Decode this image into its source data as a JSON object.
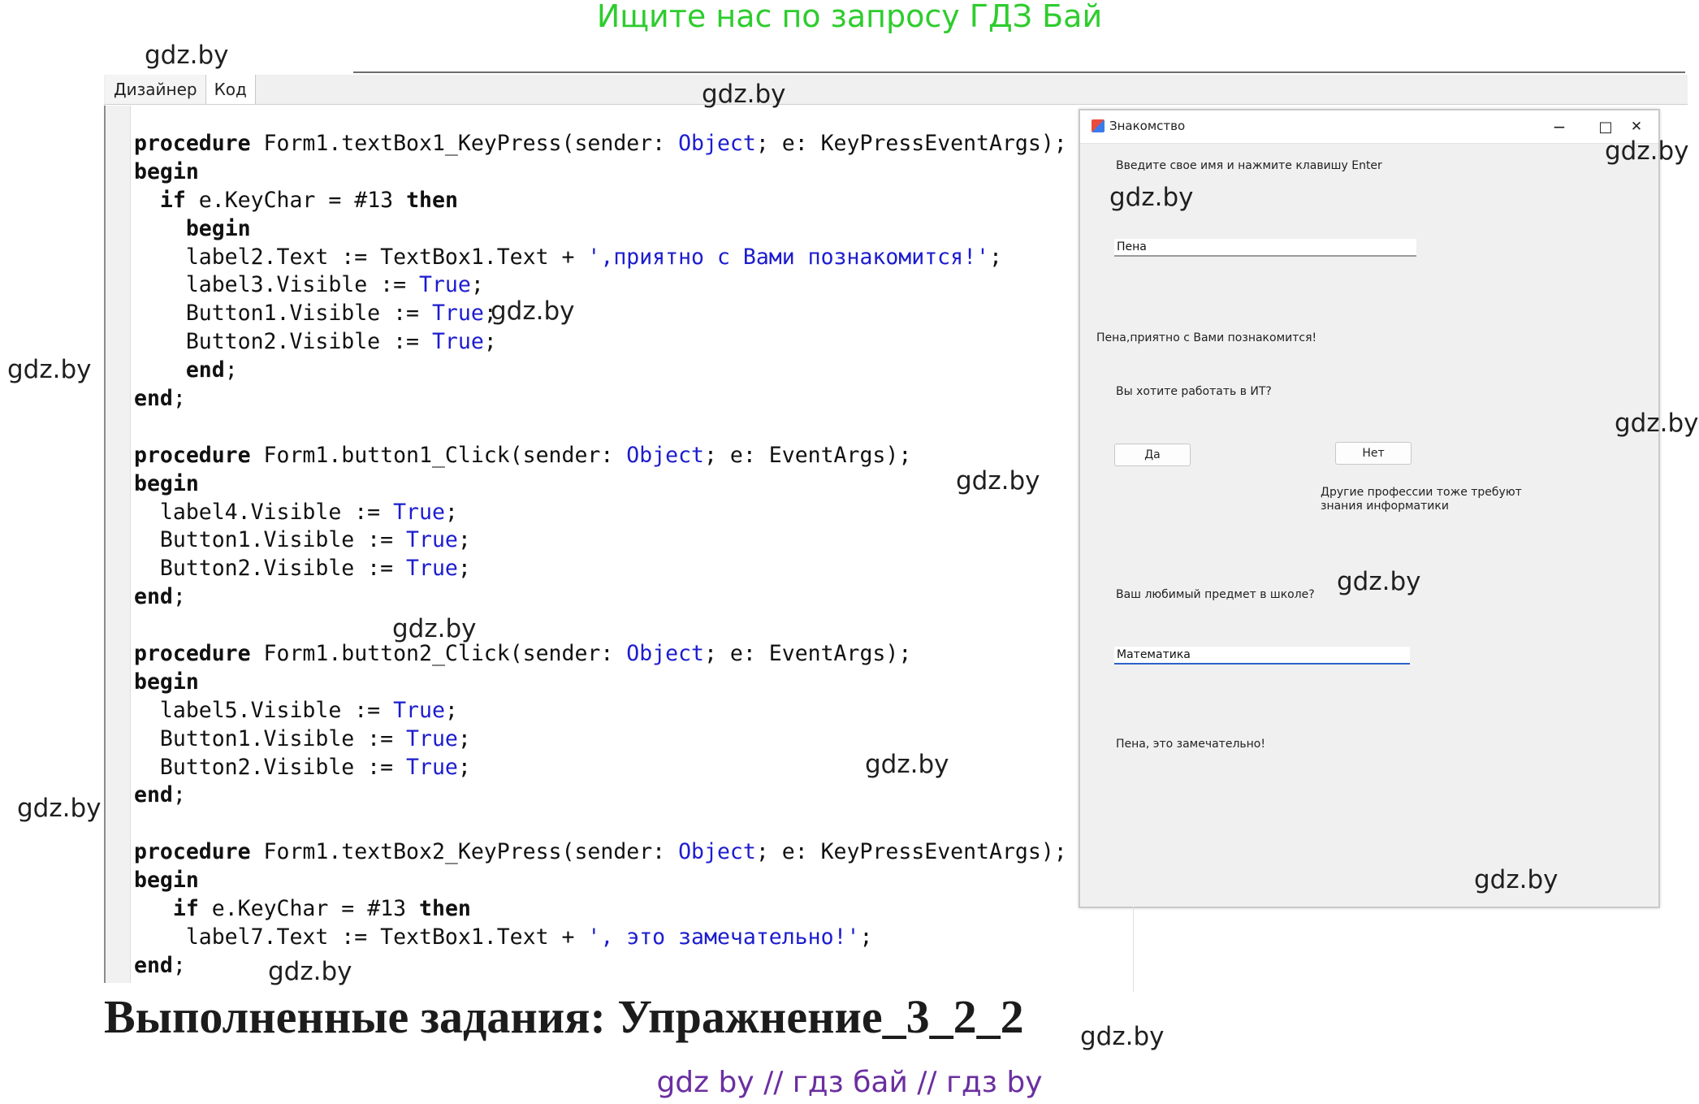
{
  "banner": "Ищите нас по запросу ГДЗ Бай",
  "watermark": "gdz.by",
  "ide": {
    "tabs": [
      "Дизайнер",
      "Код"
    ],
    "active_tab": "Код",
    "code_lines": [
      [
        {
          "t": "procedure",
          "c": "kw"
        },
        {
          "t": " Form1.textBox1_KeyPress(sender: "
        },
        {
          "t": "Object",
          "c": "ty"
        },
        {
          "t": "; e: KeyPressEventArgs);"
        }
      ],
      [
        {
          "t": "begin",
          "c": "kw"
        }
      ],
      [
        {
          "t": "  "
        },
        {
          "t": "if",
          "c": "kw"
        },
        {
          "t": " e.KeyChar = #13 "
        },
        {
          "t": "then",
          "c": "kw"
        }
      ],
      [
        {
          "t": "    "
        },
        {
          "t": "begin",
          "c": "kw"
        }
      ],
      [
        {
          "t": "    label2.Text := TextBox1.Text + "
        },
        {
          "t": "',приятно с Вами познакомится!'",
          "c": "st"
        },
        {
          "t": ";"
        }
      ],
      [
        {
          "t": "    label3.Visible := "
        },
        {
          "t": "True",
          "c": "ty"
        },
        {
          "t": ";"
        }
      ],
      [
        {
          "t": "    Button1.Visible := "
        },
        {
          "t": "True",
          "c": "ty"
        },
        {
          "t": ";"
        }
      ],
      [
        {
          "t": "    Button2.Visible := "
        },
        {
          "t": "True",
          "c": "ty"
        },
        {
          "t": ";"
        }
      ],
      [
        {
          "t": "    "
        },
        {
          "t": "end",
          "c": "kw"
        },
        {
          "t": ";"
        }
      ],
      [
        {
          "t": "end",
          "c": "kw"
        },
        {
          "t": ";"
        }
      ],
      [
        {
          "t": ""
        }
      ],
      [
        {
          "t": "procedure",
          "c": "kw"
        },
        {
          "t": " Form1.button1_Click(sender: "
        },
        {
          "t": "Object",
          "c": "ty"
        },
        {
          "t": "; e: EventArgs);"
        }
      ],
      [
        {
          "t": "begin",
          "c": "kw"
        }
      ],
      [
        {
          "t": "  label4.Visible := "
        },
        {
          "t": "True",
          "c": "ty"
        },
        {
          "t": ";"
        }
      ],
      [
        {
          "t": "  Button1.Visible := "
        },
        {
          "t": "True",
          "c": "ty"
        },
        {
          "t": ";"
        }
      ],
      [
        {
          "t": "  Button2.Visible := "
        },
        {
          "t": "True",
          "c": "ty"
        },
        {
          "t": ";"
        }
      ],
      [
        {
          "t": "end",
          "c": "kw"
        },
        {
          "t": ";"
        }
      ],
      [
        {
          "t": ""
        }
      ],
      [
        {
          "t": "procedure",
          "c": "kw"
        },
        {
          "t": " Form1.button2_Click(sender: "
        },
        {
          "t": "Object",
          "c": "ty"
        },
        {
          "t": "; e: EventArgs);"
        }
      ],
      [
        {
          "t": "begin",
          "c": "kw"
        }
      ],
      [
        {
          "t": "  label5.Visible := "
        },
        {
          "t": "True",
          "c": "ty"
        },
        {
          "t": ";"
        }
      ],
      [
        {
          "t": "  Button1.Visible := "
        },
        {
          "t": "True",
          "c": "ty"
        },
        {
          "t": ";"
        }
      ],
      [
        {
          "t": "  Button2.Visible := "
        },
        {
          "t": "True",
          "c": "ty"
        },
        {
          "t": ";"
        }
      ],
      [
        {
          "t": "end",
          "c": "kw"
        },
        {
          "t": ";"
        }
      ],
      [
        {
          "t": ""
        }
      ],
      [
        {
          "t": "procedure",
          "c": "kw"
        },
        {
          "t": " Form1.textBox2_KeyPress(sender: "
        },
        {
          "t": "Object",
          "c": "ty"
        },
        {
          "t": "; e: KeyPressEventArgs);"
        }
      ],
      [
        {
          "t": "begin",
          "c": "kw"
        }
      ],
      [
        {
          "t": "   "
        },
        {
          "t": "if",
          "c": "kw"
        },
        {
          "t": " e.KeyChar = #13 "
        },
        {
          "t": "then",
          "c": "kw"
        }
      ],
      [
        {
          "t": "    label7.Text := TextBox1.Text + "
        },
        {
          "t": "', это замечательно!'",
          "c": "st"
        },
        {
          "t": ";"
        }
      ],
      [
        {
          "t": "end",
          "c": "kw"
        },
        {
          "t": ";"
        }
      ]
    ]
  },
  "form": {
    "title": "Знакомство",
    "minimize": "−",
    "maximize": "□",
    "close": "✕",
    "prompt_name": "Введите свое имя и нажмите клавишу Enter",
    "name_value": "Пена",
    "greeting": "Пена,приятно с Вами познакомится!",
    "question_it": "Вы хотите работать в ИТ?",
    "yes_button": "Да",
    "no_button": "Нет",
    "other_professions": "Другие профессии тоже требуют знания информатики",
    "question_subject": "Ваш любимый предмет в школе?",
    "subject_value": "Математика",
    "result": "Пена, это замечательно!"
  },
  "footer": {
    "title": "Выполненные задания: Упражнение_3_2_2",
    "links": "gdz by  //  гдз бай  //  гдз by"
  }
}
